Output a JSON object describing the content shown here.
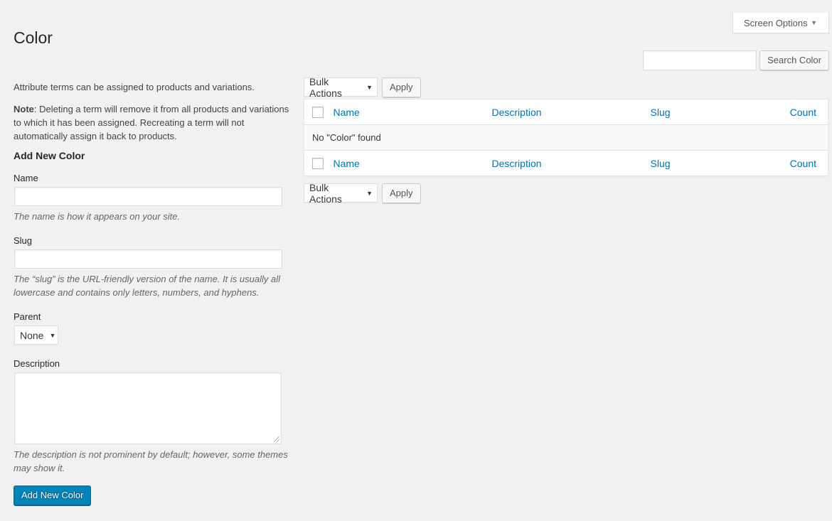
{
  "screen_options": {
    "label": "Screen Options"
  },
  "page": {
    "title": "Color"
  },
  "search": {
    "value": "",
    "button_label": "Search Color"
  },
  "info": {
    "intro": "Attribute terms can be assigned to products and variations.",
    "note_label": "Note",
    "note_text": ": Deleting a term will remove it from all products and variations to which it has been assigned. Recreating a term will not automatically assign it back to products."
  },
  "form": {
    "heading": "Add New Color",
    "name": {
      "label": "Name",
      "value": "",
      "hint": "The name is how it appears on your site."
    },
    "slug": {
      "label": "Slug",
      "value": "",
      "hint": "The “slug” is the URL-friendly version of the name. It is usually all lowercase and contains only letters, numbers, and hyphens."
    },
    "parent": {
      "label": "Parent",
      "selected": "None"
    },
    "description": {
      "label": "Description",
      "value": "",
      "hint": "The description is not prominent by default; however, some themes may show it."
    },
    "submit_label": "Add New Color"
  },
  "bulk": {
    "selected": "Bulk Actions",
    "apply_label": "Apply"
  },
  "table": {
    "columns": {
      "name": "Name",
      "description": "Description",
      "slug": "Slug",
      "count": "Count"
    },
    "empty_message": "No \"Color\" found"
  },
  "icons": {
    "dropdown": "caret-down-icon"
  }
}
